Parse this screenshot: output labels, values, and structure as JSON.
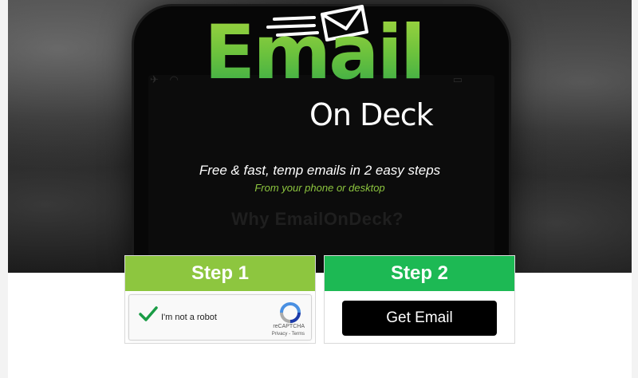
{
  "hero": {
    "logo_word": "Email",
    "logo_sub": "On Deck",
    "tagline": "Free & fast, temp emails in 2 easy steps",
    "subtagline": "From your phone or desktop",
    "background_text": "Why EmailOnDeck?"
  },
  "steps": [
    {
      "title": "Step 1"
    },
    {
      "title": "Step 2"
    }
  ],
  "captcha": {
    "label": "I'm not a robot",
    "brand": "reCAPTCHA",
    "links": "Privacy - Terms"
  },
  "actions": {
    "get_email_label": "Get Email"
  },
  "colors": {
    "step1": "#8dc63f",
    "step2": "#1db954",
    "button": "#000000",
    "tagline_accent": "#8dc63f"
  },
  "icons": [
    "envelope-icon",
    "checkmark-icon",
    "recaptcha-icon",
    "airplane-icon",
    "wifi-icon",
    "battery-icon"
  ]
}
